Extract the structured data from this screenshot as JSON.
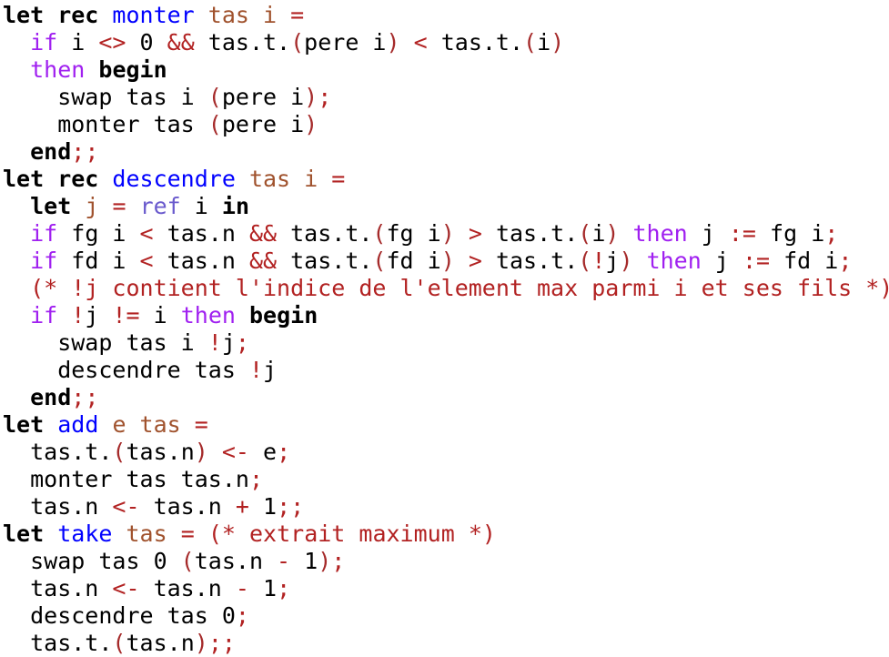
{
  "colors": {
    "keyword": "#000000",
    "function": "#0000ff",
    "variable": "#a0522d",
    "control": "#a020f0",
    "operator": "#b22222",
    "paren": "#a52a2a",
    "builtin": "#6a5acd"
  },
  "lines": [
    [
      [
        "let rec",
        "k"
      ],
      [
        " ",
        ""
      ],
      [
        "monter",
        "f"
      ],
      [
        " ",
        ""
      ],
      [
        "tas i",
        "v"
      ],
      [
        " ",
        ""
      ],
      [
        "=",
        "o"
      ]
    ],
    [
      [
        "  ",
        ""
      ],
      [
        "if",
        "c"
      ],
      [
        " i ",
        ""
      ],
      [
        "<>",
        "o"
      ],
      [
        " 0 ",
        ""
      ],
      [
        "&&",
        "o"
      ],
      [
        " tas.t.",
        ""
      ],
      [
        "(",
        "p"
      ],
      [
        "pere i",
        ""
      ],
      [
        ")",
        "p"
      ],
      [
        " ",
        ""
      ],
      [
        "<",
        "o"
      ],
      [
        " tas.t.",
        ""
      ],
      [
        "(",
        "p"
      ],
      [
        "i",
        ""
      ],
      [
        ")",
        "p"
      ]
    ],
    [
      [
        "  ",
        ""
      ],
      [
        "then",
        "c"
      ],
      [
        " ",
        ""
      ],
      [
        "begin",
        "k"
      ]
    ],
    [
      [
        "    swap tas i ",
        ""
      ],
      [
        "(",
        "p"
      ],
      [
        "pere i",
        ""
      ],
      [
        ")",
        "p"
      ],
      [
        ";",
        "o"
      ]
    ],
    [
      [
        "    monter tas ",
        ""
      ],
      [
        "(",
        "p"
      ],
      [
        "pere i",
        ""
      ],
      [
        ")",
        "p"
      ]
    ],
    [
      [
        "  ",
        ""
      ],
      [
        "end",
        "k"
      ],
      [
        ";;",
        "o"
      ]
    ],
    [
      [
        "let rec",
        "k"
      ],
      [
        " ",
        ""
      ],
      [
        "descendre",
        "f"
      ],
      [
        " ",
        ""
      ],
      [
        "tas i",
        "v"
      ],
      [
        " ",
        ""
      ],
      [
        "=",
        "o"
      ]
    ],
    [
      [
        "  ",
        ""
      ],
      [
        "let",
        "k"
      ],
      [
        " ",
        ""
      ],
      [
        "j",
        "v"
      ],
      [
        " ",
        ""
      ],
      [
        "=",
        "o"
      ],
      [
        " ",
        ""
      ],
      [
        "ref",
        "r"
      ],
      [
        " i ",
        ""
      ],
      [
        "in",
        "k"
      ]
    ],
    [
      [
        "  ",
        ""
      ],
      [
        "if",
        "c"
      ],
      [
        " fg i ",
        ""
      ],
      [
        "<",
        "o"
      ],
      [
        " tas.n ",
        ""
      ],
      [
        "&&",
        "o"
      ],
      [
        " tas.t.",
        ""
      ],
      [
        "(",
        "p"
      ],
      [
        "fg i",
        ""
      ],
      [
        ")",
        "p"
      ],
      [
        " ",
        ""
      ],
      [
        ">",
        "o"
      ],
      [
        " tas.t.",
        ""
      ],
      [
        "(",
        "p"
      ],
      [
        "i",
        ""
      ],
      [
        ")",
        "p"
      ],
      [
        " ",
        ""
      ],
      [
        "then",
        "c"
      ],
      [
        " j ",
        ""
      ],
      [
        ":=",
        "o"
      ],
      [
        " fg i",
        ""
      ],
      [
        ";",
        "o"
      ]
    ],
    [
      [
        "  ",
        ""
      ],
      [
        "if",
        "c"
      ],
      [
        " fd i ",
        ""
      ],
      [
        "<",
        "o"
      ],
      [
        " tas.n ",
        ""
      ],
      [
        "&&",
        "o"
      ],
      [
        " tas.t.",
        ""
      ],
      [
        "(",
        "p"
      ],
      [
        "fd i",
        ""
      ],
      [
        ")",
        "p"
      ],
      [
        " ",
        ""
      ],
      [
        ">",
        "o"
      ],
      [
        " tas.t.",
        ""
      ],
      [
        "(",
        "p"
      ],
      [
        "!",
        "o"
      ],
      [
        "j",
        ""
      ],
      [
        ")",
        "p"
      ],
      [
        " ",
        ""
      ],
      [
        "then",
        "c"
      ],
      [
        " j ",
        ""
      ],
      [
        ":=",
        "o"
      ],
      [
        " fd i",
        ""
      ],
      [
        ";",
        "o"
      ]
    ],
    [
      [
        "  ",
        ""
      ],
      [
        "(* !j contient l'indice de l'element max parmi i et ses fils *)",
        "o"
      ]
    ],
    [
      [
        "  ",
        ""
      ],
      [
        "if",
        "c"
      ],
      [
        " ",
        ""
      ],
      [
        "!",
        "o"
      ],
      [
        "j ",
        ""
      ],
      [
        "!=",
        "o"
      ],
      [
        " i ",
        ""
      ],
      [
        "then",
        "c"
      ],
      [
        " ",
        ""
      ],
      [
        "begin",
        "k"
      ]
    ],
    [
      [
        "    swap tas i ",
        ""
      ],
      [
        "!",
        "o"
      ],
      [
        "j",
        ""
      ],
      [
        ";",
        "o"
      ]
    ],
    [
      [
        "    descendre tas ",
        ""
      ],
      [
        "!",
        "o"
      ],
      [
        "j",
        ""
      ]
    ],
    [
      [
        "  ",
        ""
      ],
      [
        "end",
        "k"
      ],
      [
        ";;",
        "o"
      ]
    ],
    [
      [
        "let",
        "k"
      ],
      [
        " ",
        ""
      ],
      [
        "add",
        "f"
      ],
      [
        " ",
        ""
      ],
      [
        "e tas",
        "v"
      ],
      [
        " ",
        ""
      ],
      [
        "=",
        "o"
      ]
    ],
    [
      [
        "  tas.t.",
        ""
      ],
      [
        "(",
        "p"
      ],
      [
        "tas.n",
        ""
      ],
      [
        ")",
        "p"
      ],
      [
        " ",
        ""
      ],
      [
        "<-",
        "o"
      ],
      [
        " e",
        ""
      ],
      [
        ";",
        "o"
      ]
    ],
    [
      [
        "  monter tas tas.n",
        ""
      ],
      [
        ";",
        "o"
      ]
    ],
    [
      [
        "  tas.n ",
        ""
      ],
      [
        "<-",
        "o"
      ],
      [
        " tas.n ",
        ""
      ],
      [
        "+",
        "o"
      ],
      [
        " 1",
        ""
      ],
      [
        ";;",
        "o"
      ]
    ],
    [
      [
        "let",
        "k"
      ],
      [
        " ",
        ""
      ],
      [
        "take",
        "f"
      ],
      [
        " ",
        ""
      ],
      [
        "tas",
        "v"
      ],
      [
        " ",
        ""
      ],
      [
        "=",
        "o"
      ],
      [
        " ",
        ""
      ],
      [
        "(* extrait maximum *)",
        "o"
      ]
    ],
    [
      [
        "  swap tas 0 ",
        ""
      ],
      [
        "(",
        "p"
      ],
      [
        "tas.n ",
        ""
      ],
      [
        "-",
        "o"
      ],
      [
        " 1",
        ""
      ],
      [
        ")",
        "p"
      ],
      [
        ";",
        "o"
      ]
    ],
    [
      [
        "  tas.n ",
        ""
      ],
      [
        "<-",
        "o"
      ],
      [
        " tas.n ",
        ""
      ],
      [
        "-",
        "o"
      ],
      [
        " 1",
        ""
      ],
      [
        ";",
        "o"
      ]
    ],
    [
      [
        "  descendre tas 0",
        ""
      ],
      [
        ";",
        "o"
      ]
    ],
    [
      [
        "  tas.t.",
        ""
      ],
      [
        "(",
        "p"
      ],
      [
        "tas.n",
        ""
      ],
      [
        ")",
        "p"
      ],
      [
        ";;",
        "o"
      ]
    ]
  ]
}
